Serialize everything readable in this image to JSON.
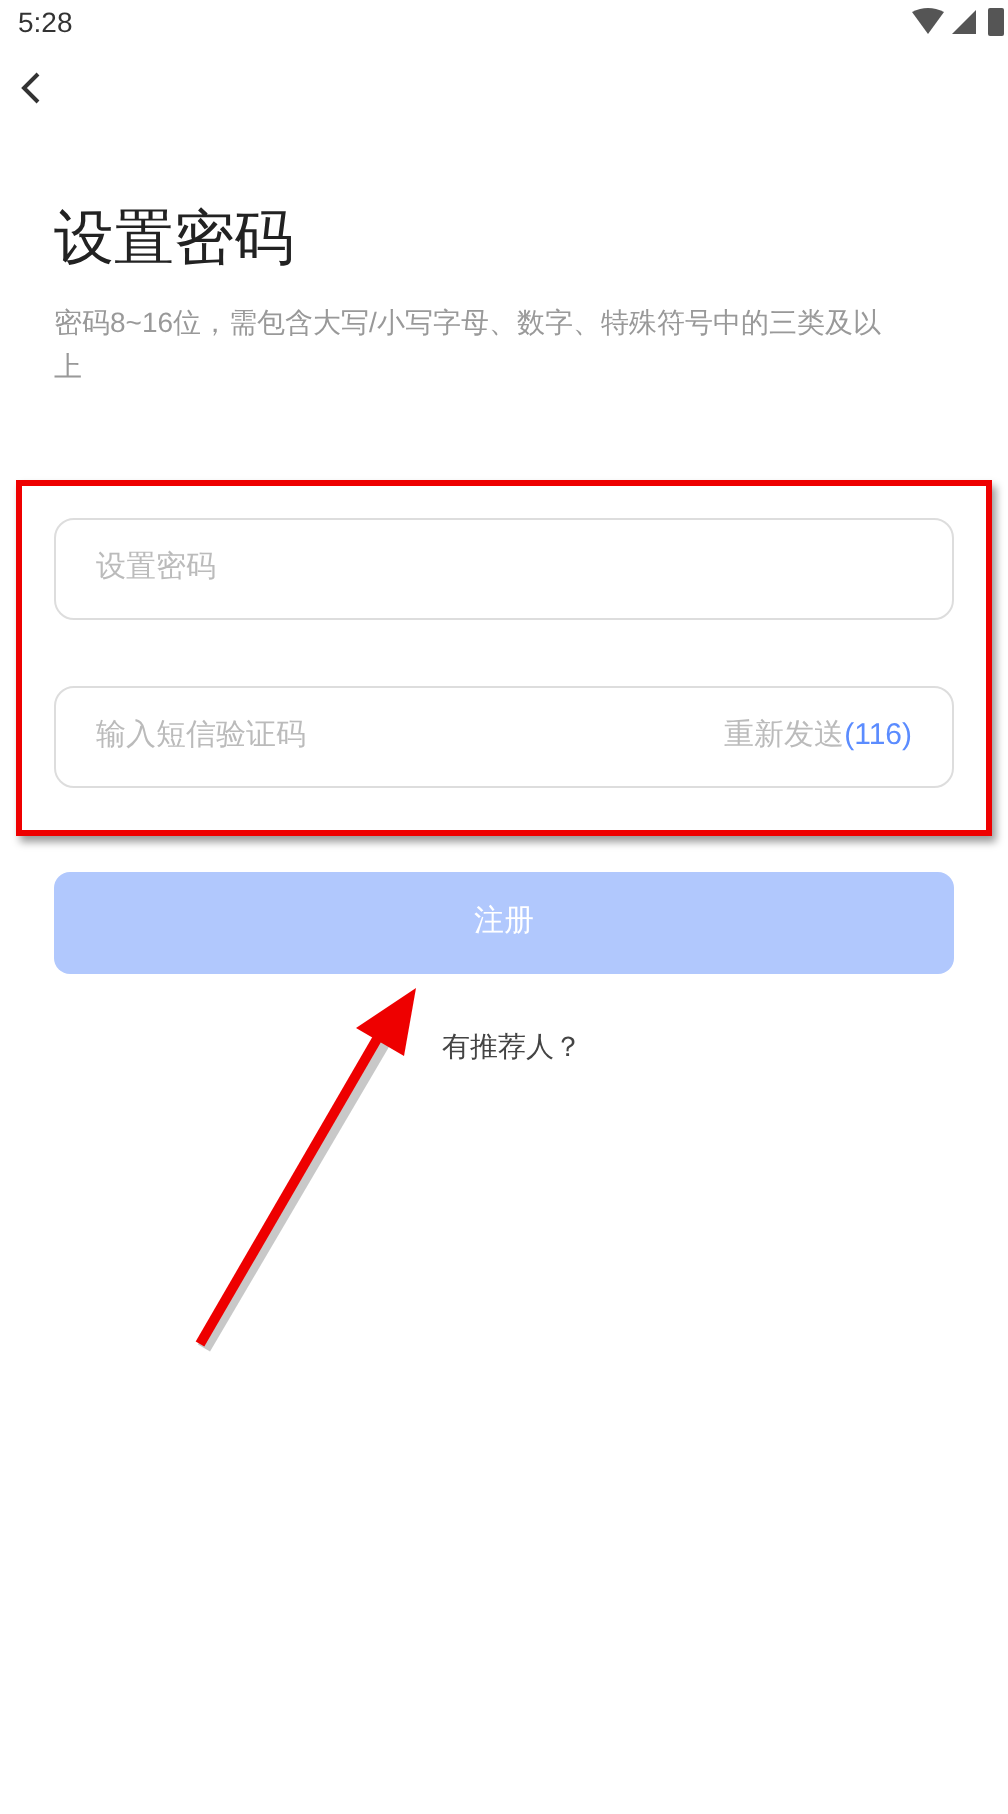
{
  "status_bar": {
    "time": "5:28"
  },
  "title": "设置密码",
  "hint": "密码8~16位，需包含大写/小写字母、数字、特殊符号中的三类及以上",
  "fields": [
    {
      "placeholder": "设置密码"
    },
    {
      "placeholder": "输入短信验证码",
      "resend_label": "重新发送",
      "countdown": "(116)"
    }
  ],
  "register_button": {
    "label": "注册",
    "disabled": true
  },
  "referrer_link": "有推荐人？"
}
